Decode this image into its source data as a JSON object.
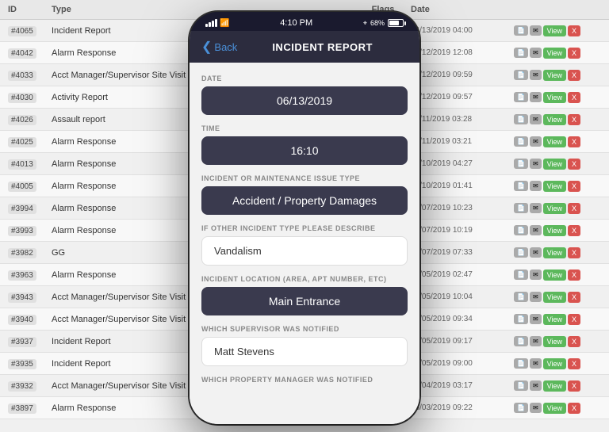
{
  "table": {
    "headers": {
      "id": "ID",
      "type": "Type",
      "flags": "Flags",
      "date": "Date"
    },
    "rows": [
      {
        "id": "#4065",
        "type": "Incident Report",
        "flags": [
          "blue",
          "red"
        ],
        "date": "06/13/2019 04:00"
      },
      {
        "id": "#4042",
        "type": "Alarm Response",
        "flags": [
          "blue",
          "red"
        ],
        "date": "06/12/2019 12:08"
      },
      {
        "id": "#4033",
        "type": "Acct Manager/Supervisor Site Visit Report",
        "flags": [
          "gray"
        ],
        "date": "06/12/2019 09:59"
      },
      {
        "id": "#4030",
        "type": "Activity Report",
        "flags": [],
        "date": "06/12/2019 09:57"
      },
      {
        "id": "#4026",
        "type": "Assault report",
        "flags": [
          "gray"
        ],
        "date": "06/11/2019 03:28"
      },
      {
        "id": "#4025",
        "type": "Alarm Response",
        "flags": [
          "blue",
          "red"
        ],
        "date": "06/11/2019 03:21"
      },
      {
        "id": "#4013",
        "type": "Alarm Response",
        "flags": [],
        "date": "06/10/2019 04:27"
      },
      {
        "id": "#4005",
        "type": "Alarm Response",
        "flags": [
          "blue",
          "red"
        ],
        "date": "06/10/2019 01:41"
      },
      {
        "id": "#3994",
        "type": "Alarm Response",
        "flags": [],
        "date": "06/07/2019 10:23"
      },
      {
        "id": "#3993",
        "type": "Alarm Response",
        "flags": [],
        "date": "06/07/2019 10:19"
      },
      {
        "id": "#3982",
        "type": "GG",
        "flags": [
          "gray",
          "red"
        ],
        "date": "06/07/2019 07:33"
      },
      {
        "id": "#3963",
        "type": "Alarm Response",
        "flags": [
          "blue",
          "red"
        ],
        "date": "06/05/2019 02:47"
      },
      {
        "id": "#3943",
        "type": "Acct Manager/Supervisor Site Visit Report",
        "flags": [],
        "date": "06/05/2019 10:04"
      },
      {
        "id": "#3940",
        "type": "Acct Manager/Supervisor Site Visit Report",
        "flags": [
          "gray"
        ],
        "date": "06/05/2019 09:34"
      },
      {
        "id": "#3937",
        "type": "Incident Report",
        "flags": [
          "blue",
          "blue",
          "red"
        ],
        "date": "06/05/2019 09:17"
      },
      {
        "id": "#3935",
        "type": "Incident Report",
        "flags": [
          "blue",
          "blue",
          "red"
        ],
        "date": "06/05/2019 09:00"
      },
      {
        "id": "#3932",
        "type": "Acct Manager/Supervisor Site Visit Report",
        "flags": [
          "gray"
        ],
        "date": "06/04/2019 03:17"
      },
      {
        "id": "#3897",
        "type": "Alarm Response",
        "flags": [],
        "date": "06/03/2019 09:22"
      }
    ]
  },
  "phone": {
    "status": {
      "time": "4:10 PM",
      "battery_pct": "68%"
    },
    "nav": {
      "back_label": "Back",
      "title": "INCIDENT REPORT"
    },
    "form": {
      "date_label": "DATE",
      "date_value": "06/13/2019",
      "time_label": "TIME",
      "time_value": "16:10",
      "issue_type_label": "INCIDENT OR MAINTENANCE ISSUE TYPE",
      "issue_type_value": "Accident / Property Damages",
      "other_type_label": "IF OTHER INCIDENT TYPE PLEASE DESCRIBE",
      "other_type_value": "Vandalism",
      "location_label": "INCIDENT LOCATION (AREA, APT NUMBER, ETC)",
      "location_value": "Main Entrance",
      "supervisor_label": "WHICH SUPERVISOR WAS NOTIFIED",
      "supervisor_value": "Matt Stevens",
      "property_manager_label": "WHICH PROPERTY MANAGER WAS NOTIFIED"
    }
  }
}
